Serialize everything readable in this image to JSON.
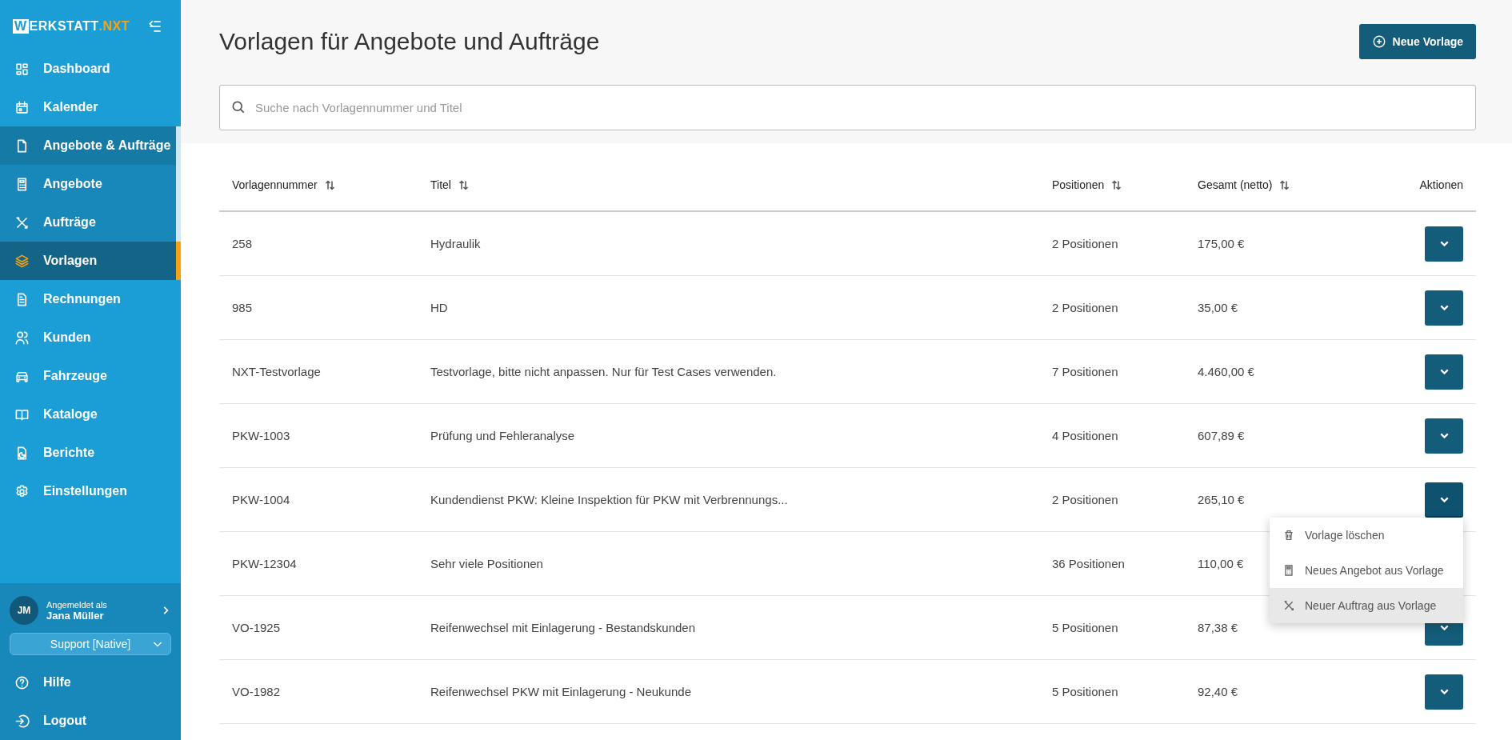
{
  "sidebar": {
    "logo": {
      "mark": "W",
      "name": "ERKSTATT",
      "suffix": ".NXT"
    },
    "items": [
      {
        "label": "Dashboard",
        "selected": false
      },
      {
        "label": "Kalender",
        "selected": false
      },
      {
        "label": "Angebote & Aufträge",
        "selected": false,
        "expanded": true,
        "children": [
          {
            "label": "Angebote",
            "selected": false
          },
          {
            "label": "Aufträge",
            "selected": false
          },
          {
            "label": "Vorlagen",
            "selected": true
          }
        ]
      },
      {
        "label": "Rechnungen",
        "selected": false
      },
      {
        "label": "Kunden",
        "selected": false
      },
      {
        "label": "Fahrzeuge",
        "selected": false
      },
      {
        "label": "Kataloge",
        "selected": false
      },
      {
        "label": "Berichte",
        "selected": false
      },
      {
        "label": "Einstellungen",
        "selected": false
      }
    ],
    "user": {
      "initials": "JM",
      "caption": "Angemeldet als",
      "name": "Jana Müller",
      "role": "Support [Native]"
    },
    "footer_items": [
      {
        "label": "Hilfe"
      },
      {
        "label": "Logout"
      }
    ]
  },
  "page": {
    "title": "Vorlagen für Angebote und Aufträge",
    "new_button": "Neue Vorlage",
    "search": {
      "placeholder": "Suche nach Vorlagennummer und Titel"
    }
  },
  "table": {
    "columns": [
      {
        "label": "Vorlagennummer",
        "sortable": true
      },
      {
        "label": "Titel",
        "sortable": true
      },
      {
        "label": "Positionen",
        "sortable": true
      },
      {
        "label": "Gesamt (netto)",
        "sortable": true
      },
      {
        "label": "Aktionen",
        "sortable": false
      }
    ],
    "rows": [
      {
        "number": "258",
        "title": "Hydraulik",
        "positions": "2 Positionen",
        "total": "175,00 €",
        "menu_open": false
      },
      {
        "number": "985",
        "title": "HD",
        "positions": "2 Positionen",
        "total": "35,00 €",
        "menu_open": false
      },
      {
        "number": "NXT-Testvorlage",
        "title": "Testvorlage, bitte nicht anpassen. Nur für Test Cases verwenden.",
        "positions": "7 Positionen",
        "total": "4.460,00 €",
        "menu_open": false
      },
      {
        "number": "PKW-1003",
        "title": "Prüfung und Fehleranalyse",
        "positions": "4 Positionen",
        "total": "607,89 €",
        "menu_open": false
      },
      {
        "number": "PKW-1004",
        "title": "Kundendienst PKW: Kleine Inspektion für PKW mit Verbrennungs...",
        "positions": "2 Positionen",
        "total": "265,10 €",
        "menu_open": true
      },
      {
        "number": "PKW-12304",
        "title": "Sehr viele Positionen",
        "positions": "36 Positionen",
        "total": "110,00 €",
        "menu_open": false
      },
      {
        "number": "VO-1925",
        "title": "Reifenwechsel mit Einlagerung - Bestandskunden",
        "positions": "5 Positionen",
        "total": "87,38 €",
        "menu_open": false
      },
      {
        "number": "VO-1982",
        "title": "Reifenwechsel PKW mit Einlagerung - Neukunde",
        "positions": "5 Positionen",
        "total": "92,40 €",
        "menu_open": false
      }
    ]
  },
  "action_menu": {
    "items": [
      {
        "label": "Vorlage löschen",
        "highlighted": false
      },
      {
        "label": "Neues Angebot aus Vorlage",
        "highlighted": false
      },
      {
        "label": "Neuer Auftrag aus Vorlage",
        "highlighted": true
      }
    ]
  }
}
